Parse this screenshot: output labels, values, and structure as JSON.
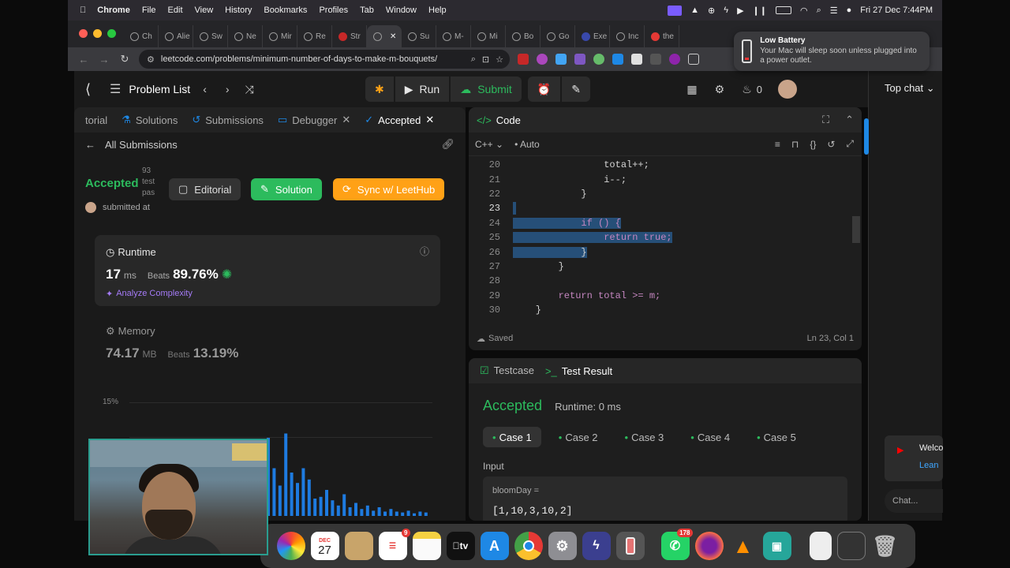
{
  "menubar": {
    "app": "Chrome",
    "items": [
      "File",
      "Edit",
      "View",
      "History",
      "Bookmarks",
      "Profiles",
      "Tab",
      "Window",
      "Help"
    ],
    "clock": "Fri 27 Dec  7:44PM"
  },
  "tabs": [
    "Ch",
    "Alie",
    "Sw",
    "Ne",
    "Mir",
    "Re",
    "Str",
    "",
    "Su",
    "M-",
    "Mi",
    "Bo",
    "Go",
    "Exe",
    "Inc",
    "the"
  ],
  "address": {
    "url": "leetcode.com/problems/minimum-number-of-days-to-make-m-bouquets/"
  },
  "notification": {
    "title": "Low Battery",
    "body": "Your Mac will sleep soon unless plugged into a power outlet."
  },
  "header": {
    "problem_list": "Problem List",
    "run": "Run",
    "submit": "Submit",
    "streak": "0",
    "top_chat": "Top chat"
  },
  "left_tabs": [
    {
      "label": "torial"
    },
    {
      "label": "Solutions"
    },
    {
      "label": "Submissions"
    },
    {
      "label": "Debugger"
    },
    {
      "label": "Accepted"
    }
  ],
  "submission": {
    "back_label": "All Submissions",
    "status": "Accepted",
    "testcases_lines": [
      "93",
      "test",
      "pas"
    ],
    "submitted_at": "submitted at",
    "editorial_btn": "Editorial",
    "solution_btn": "Solution",
    "sync_btn": "Sync w/ LeetHub"
  },
  "runtime": {
    "label": "Runtime",
    "value": "17",
    "unit": "ms",
    "beats_label": "Beats",
    "beats": "89.76%",
    "analyze": "Analyze Complexity"
  },
  "memory": {
    "label": "Memory",
    "value": "74.17",
    "unit": "MB",
    "beats_label": "Beats",
    "beats": "13.19%"
  },
  "chart_data": {
    "type": "bar",
    "ytick": "15%",
    "values": [
      0.9,
      0.55,
      0.35,
      0.95,
      0.5,
      0.38,
      0.55,
      0.42,
      0.2,
      0.22,
      0.3,
      0.18,
      0.12,
      0.25,
      0.1,
      0.15,
      0.08,
      0.12,
      0.06,
      0.1,
      0.05,
      0.08,
      0.05,
      0.04,
      0.06,
      0.03,
      0.05,
      0.04
    ]
  },
  "code": {
    "title": "Code",
    "language": "C++",
    "mode": "Auto",
    "status": "Saved",
    "cursor": "Ln 23, Col 1",
    "lines": [
      {
        "n": "20",
        "text": "                total++;"
      },
      {
        "n": "21",
        "text": "                i--;"
      },
      {
        "n": "22",
        "text": "            }"
      },
      {
        "n": "23",
        "text": ""
      },
      {
        "n": "24",
        "text": "            if () {"
      },
      {
        "n": "25",
        "text": "                return true;"
      },
      {
        "n": "26",
        "text": "            }"
      },
      {
        "n": "27",
        "text": "        }"
      },
      {
        "n": "28",
        "text": ""
      },
      {
        "n": "29",
        "text": "        return total >= m;"
      },
      {
        "n": "30",
        "text": "    }"
      }
    ]
  },
  "test": {
    "testcase_tab": "Testcase",
    "result_tab": "Test Result",
    "status": "Accepted",
    "runtime": "Runtime: 0 ms",
    "cases": [
      "Case 1",
      "Case 2",
      "Case 3",
      "Case 4",
      "Case 5"
    ],
    "input_label": "Input",
    "param_name": "bloomDay =",
    "param_value": "[1,10,3,10,2]"
  },
  "sidebar": {
    "welcome": "Welco",
    "learn": "Lean",
    "chat_placeholder": "Chat..."
  },
  "dock": {
    "calendar_month": "DEC",
    "calendar_day": "27",
    "reminders_badge": "9",
    "whatsapp_badge": "178",
    "appletv": "tv"
  }
}
